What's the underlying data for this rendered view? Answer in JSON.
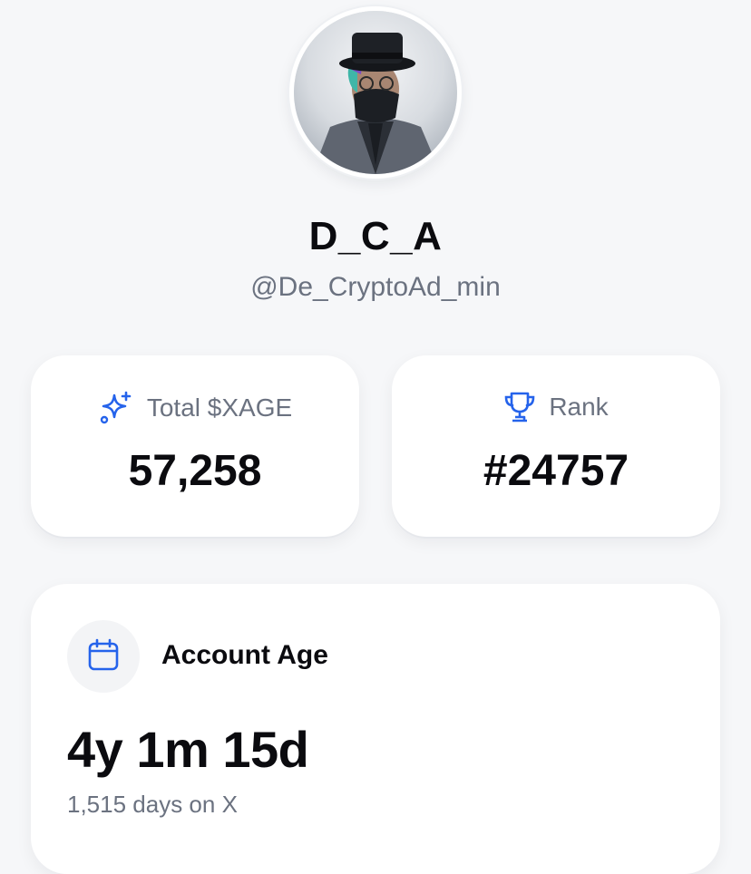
{
  "profile": {
    "display_name": "D_C_A",
    "handle": "@De_CryptoAd_min",
    "avatar_icon": "masked-man-top-hat-avatar"
  },
  "stats": {
    "total": {
      "icon": "sparkles-icon",
      "label": "Total $XAGE",
      "value": "57,258"
    },
    "rank": {
      "icon": "trophy-icon",
      "label": "Rank",
      "value": "#24757"
    }
  },
  "account_age": {
    "icon": "calendar-icon",
    "title": "Account Age",
    "value": "4y 1m 15d",
    "subtitle": "1,515 days on X"
  },
  "colors": {
    "accent": "#2563eb",
    "background": "#f6f7f9",
    "card": "#ffffff",
    "muted_text": "#6b7280",
    "primary_text": "#0b0b0f"
  }
}
